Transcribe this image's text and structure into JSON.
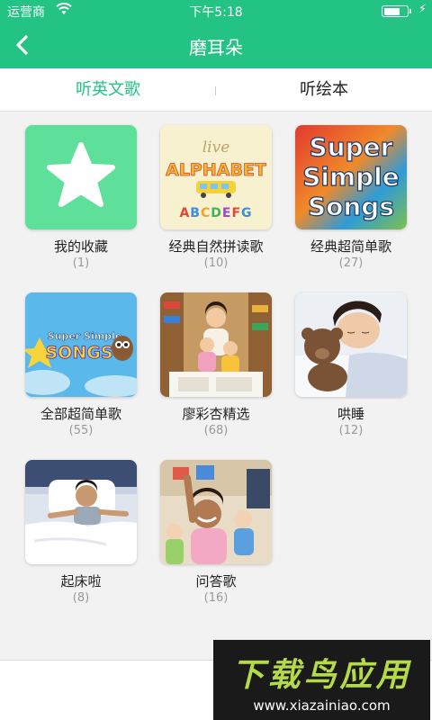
{
  "status_bar": {
    "carrier": "运营商",
    "time": "下午5:18"
  },
  "nav": {
    "title": "磨耳朵"
  },
  "tabs": [
    {
      "label": "听英文歌",
      "active": true
    },
    {
      "label": "听绘本",
      "active": false
    }
  ],
  "items": [
    {
      "title": "我的收藏",
      "count": "(1)",
      "thumb_text": ""
    },
    {
      "title": "经典自然拼读歌",
      "count": "(10)",
      "thumb_text": "live ALPHABET",
      "thumb_letters": "ABCDEFG"
    },
    {
      "title": "经典超简单歌",
      "count": "(27)",
      "thumb_lines": [
        "Super",
        "Simple",
        "Songs"
      ]
    },
    {
      "title": "全部超简单歌",
      "count": "(55)",
      "thumb_lines": [
        "Super Simple",
        "SONGS"
      ]
    },
    {
      "title": "廖彩杏精选",
      "count": "(68)"
    },
    {
      "title": "哄睡",
      "count": "(12)"
    },
    {
      "title": "起床啦",
      "count": "(8)"
    },
    {
      "title": "问答歌",
      "count": "(16)"
    }
  ],
  "watermark": {
    "brand": "下载鸟应用",
    "url": "www.xiazainiao.com"
  },
  "colors": {
    "accent": "#23c383",
    "favorite_bg": "#5ee09b"
  }
}
